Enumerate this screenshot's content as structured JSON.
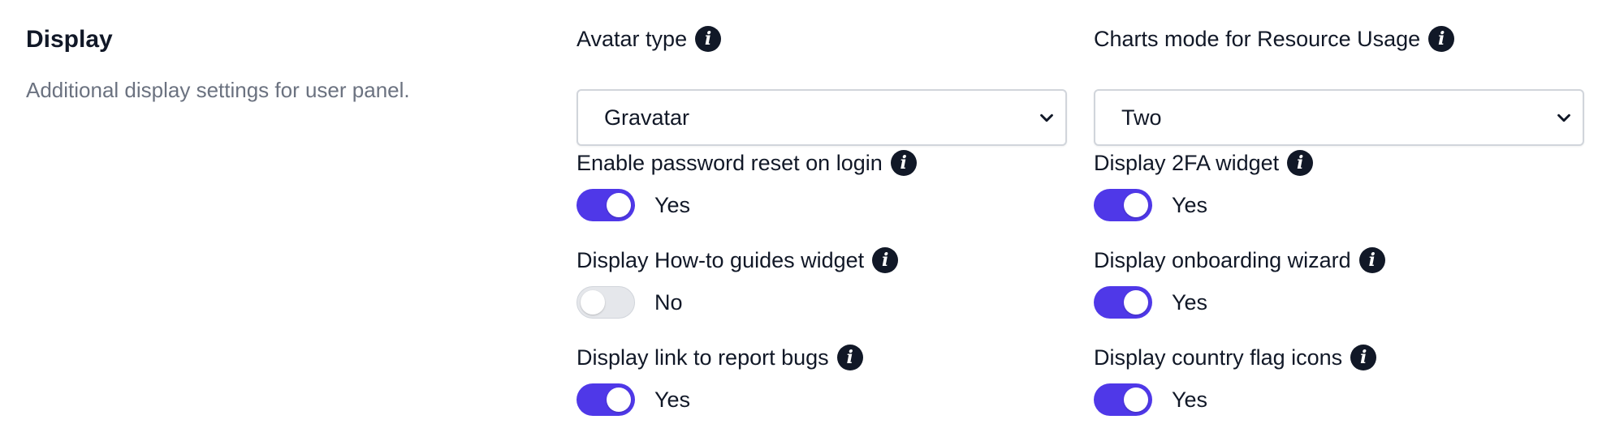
{
  "section": {
    "title": "Display",
    "description": "Additional display settings for user panel."
  },
  "fields": {
    "avatar_type": {
      "label": "Avatar type",
      "value": "Gravatar"
    },
    "charts_mode": {
      "label": "Charts mode for Resource Usage",
      "value": "Two"
    },
    "password_reset": {
      "label": "Enable password reset on login",
      "state": "Yes",
      "on": true
    },
    "twofa_widget": {
      "label": "Display 2FA widget",
      "state": "Yes",
      "on": true
    },
    "howto_widget": {
      "label": "Display How-to guides widget",
      "state": "No",
      "on": false
    },
    "onboarding": {
      "label": "Display onboarding wizard",
      "state": "Yes",
      "on": true
    },
    "report_bugs": {
      "label": "Display link to report bugs",
      "state": "Yes",
      "on": true
    },
    "country_flags": {
      "label": "Display country flag icons",
      "state": "Yes",
      "on": true
    }
  },
  "colors": {
    "toggle_on": "#4f38e8",
    "toggle_off": "#e5e7eb",
    "info_icon": "#111827",
    "muted_text": "#6b7280"
  },
  "icons": {
    "info": "info-icon",
    "select_arrow": "chevron-down-icon"
  }
}
